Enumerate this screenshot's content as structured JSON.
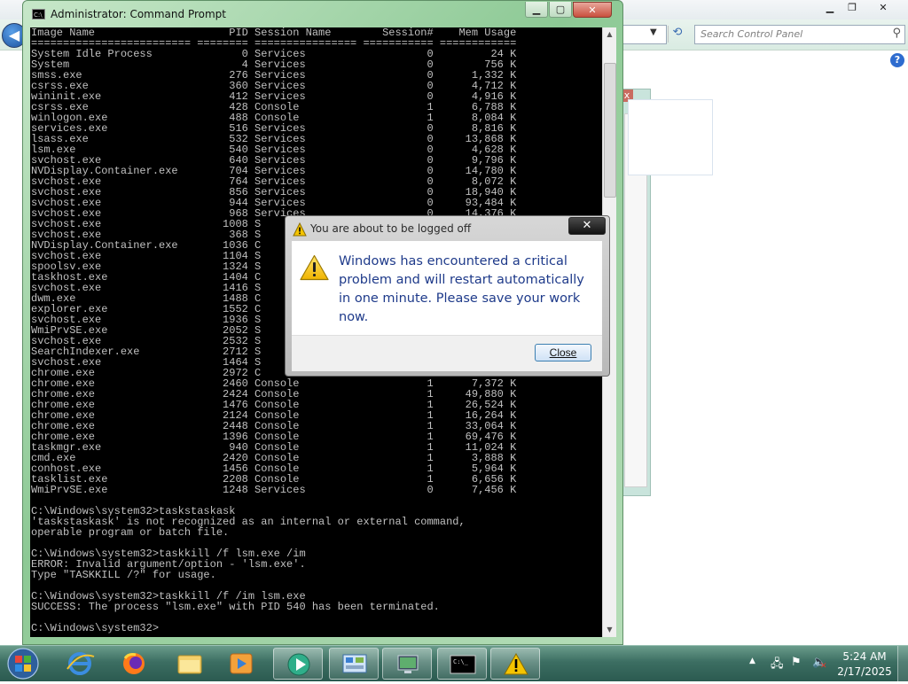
{
  "control_panel": {
    "search_placeholder": "Search Control Panel",
    "help_glyph": "?"
  },
  "cmd": {
    "title": "Administrator: Command Prompt",
    "icon_text": "C:\\",
    "lines": [
      "Image Name                     PID Session Name        Session#    Mem Usage",
      "========================= ======== ================ =========== ============",
      "System Idle Process              0 Services                   0         24 K",
      "System                           4 Services                   0        756 K",
      "smss.exe                       276 Services                   0      1,332 K",
      "csrss.exe                      360 Services                   0      4,712 K",
      "wininit.exe                    412 Services                   0      4,916 K",
      "csrss.exe                      428 Console                    1      6,788 K",
      "winlogon.exe                   488 Console                    1      8,084 K",
      "services.exe                   516 Services                   0      8,816 K",
      "lsass.exe                      532 Services                   0     13,868 K",
      "lsm.exe                        540 Services                   0      4,628 K",
      "svchost.exe                    640 Services                   0      9,796 K",
      "NVDisplay.Container.exe        704 Services                   0     14,780 K",
      "svchost.exe                    764 Services                   0      8,072 K",
      "svchost.exe                    856 Services                   0     18,940 K",
      "svchost.exe                    944 Services                   0     93,484 K",
      "svchost.exe                    968 Services                   0     14,376 K",
      "svchost.exe                   1008 S",
      "svchost.exe                    368 S",
      "NVDisplay.Container.exe       1036 C",
      "svchost.exe                   1104 S",
      "spoolsv.exe                   1324 S",
      "taskhost.exe                  1404 C",
      "svchost.exe                   1416 S",
      "dwm.exe                       1488 C",
      "explorer.exe                  1552 C",
      "svchost.exe                   1936 S",
      "WmiPrvSE.exe                  2052 S",
      "svchost.exe                   2532 S",
      "SearchIndexer.exe             2712 S",
      "svchost.exe                   1464 S",
      "chrome.exe                    2972 C",
      "chrome.exe                    2460 Console                    1      7,372 K",
      "chrome.exe                    2424 Console                    1     49,880 K",
      "chrome.exe                    1476 Console                    1     26,524 K",
      "chrome.exe                    2124 Console                    1     16,264 K",
      "chrome.exe                    2448 Console                    1     33,064 K",
      "chrome.exe                    1396 Console                    1     69,476 K",
      "taskmgr.exe                    940 Console                    1     11,024 K",
      "cmd.exe                       2420 Console                    1      3,888 K",
      "conhost.exe                   1456 Console                    1      5,964 K",
      "tasklist.exe                  2208 Console                    1      6,656 K",
      "WmiPrvSE.exe                  1248 Services                   0      7,456 K",
      "",
      "C:\\Windows\\system32>taskstaskask",
      "'taskstaskask' is not recognized as an internal or external command,",
      "operable program or batch file.",
      "",
      "C:\\Windows\\system32>taskkill /f lsm.exe /im",
      "ERROR: Invalid argument/option - 'lsm.exe'.",
      "Type \"TASKKILL /?\" for usage.",
      "",
      "C:\\Windows\\system32>taskkill /f /im lsm.exe",
      "SUCCESS: The process \"lsm.exe\" with PID 540 has been terminated.",
      "",
      "C:\\Windows\\system32>"
    ]
  },
  "dialog": {
    "title": "You are about to be logged off",
    "message": "Windows has encountered a critical problem and will restart automatically in one minute. Please save your work now.",
    "close_button": "Close"
  },
  "taskbar": {
    "items": [
      {
        "name": "internet-explorer-icon"
      },
      {
        "name": "firefox-icon"
      },
      {
        "name": "windows-explorer-icon"
      },
      {
        "name": "media-player-icon"
      },
      {
        "name": "media-center-icon"
      },
      {
        "name": "control-panel-icon"
      },
      {
        "name": "remote-desktop-icon"
      },
      {
        "name": "command-prompt-icon"
      },
      {
        "name": "warning-icon"
      }
    ],
    "clock_time": "5:24 AM",
    "clock_date": "2/17/2025"
  },
  "colors": {
    "console_bg": "#000000",
    "console_fg": "#c0c0c0",
    "dialog_text": "#1e3a8a",
    "taskbar": "#3c6e62"
  }
}
